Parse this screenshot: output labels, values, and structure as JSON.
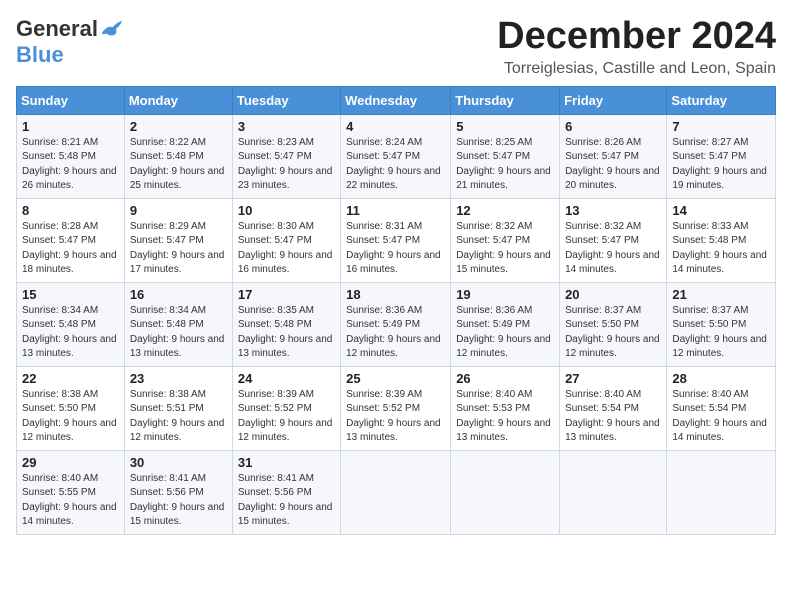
{
  "header": {
    "logo_general": "General",
    "logo_blue": "Blue",
    "month_title": "December 2024",
    "location": "Torreiglesias, Castille and Leon, Spain"
  },
  "calendar": {
    "columns": [
      "Sunday",
      "Monday",
      "Tuesday",
      "Wednesday",
      "Thursday",
      "Friday",
      "Saturday"
    ],
    "weeks": [
      [
        {
          "day": "",
          "info": ""
        },
        {
          "day": "2",
          "info": "Sunrise: 8:22 AM\nSunset: 5:48 PM\nDaylight: 9 hours and 25 minutes."
        },
        {
          "day": "3",
          "info": "Sunrise: 8:23 AM\nSunset: 5:47 PM\nDaylight: 9 hours and 23 minutes."
        },
        {
          "day": "4",
          "info": "Sunrise: 8:24 AM\nSunset: 5:47 PM\nDaylight: 9 hours and 22 minutes."
        },
        {
          "day": "5",
          "info": "Sunrise: 8:25 AM\nSunset: 5:47 PM\nDaylight: 9 hours and 21 minutes."
        },
        {
          "day": "6",
          "info": "Sunrise: 8:26 AM\nSunset: 5:47 PM\nDaylight: 9 hours and 20 minutes."
        },
        {
          "day": "7",
          "info": "Sunrise: 8:27 AM\nSunset: 5:47 PM\nDaylight: 9 hours and 19 minutes."
        }
      ],
      [
        {
          "day": "1",
          "info": "Sunrise: 8:21 AM\nSunset: 5:48 PM\nDaylight: 9 hours and 26 minutes."
        },
        {
          "day": "9",
          "info": "Sunrise: 8:29 AM\nSunset: 5:47 PM\nDaylight: 9 hours and 17 minutes."
        },
        {
          "day": "10",
          "info": "Sunrise: 8:30 AM\nSunset: 5:47 PM\nDaylight: 9 hours and 16 minutes."
        },
        {
          "day": "11",
          "info": "Sunrise: 8:31 AM\nSunset: 5:47 PM\nDaylight: 9 hours and 16 minutes."
        },
        {
          "day": "12",
          "info": "Sunrise: 8:32 AM\nSunset: 5:47 PM\nDaylight: 9 hours and 15 minutes."
        },
        {
          "day": "13",
          "info": "Sunrise: 8:32 AM\nSunset: 5:47 PM\nDaylight: 9 hours and 14 minutes."
        },
        {
          "day": "14",
          "info": "Sunrise: 8:33 AM\nSunset: 5:48 PM\nDaylight: 9 hours and 14 minutes."
        }
      ],
      [
        {
          "day": "8",
          "info": "Sunrise: 8:28 AM\nSunset: 5:47 PM\nDaylight: 9 hours and 18 minutes."
        },
        {
          "day": "16",
          "info": "Sunrise: 8:34 AM\nSunset: 5:48 PM\nDaylight: 9 hours and 13 minutes."
        },
        {
          "day": "17",
          "info": "Sunrise: 8:35 AM\nSunset: 5:48 PM\nDaylight: 9 hours and 13 minutes."
        },
        {
          "day": "18",
          "info": "Sunrise: 8:36 AM\nSunset: 5:49 PM\nDaylight: 9 hours and 12 minutes."
        },
        {
          "day": "19",
          "info": "Sunrise: 8:36 AM\nSunset: 5:49 PM\nDaylight: 9 hours and 12 minutes."
        },
        {
          "day": "20",
          "info": "Sunrise: 8:37 AM\nSunset: 5:50 PM\nDaylight: 9 hours and 12 minutes."
        },
        {
          "day": "21",
          "info": "Sunrise: 8:37 AM\nSunset: 5:50 PM\nDaylight: 9 hours and 12 minutes."
        }
      ],
      [
        {
          "day": "15",
          "info": "Sunrise: 8:34 AM\nSunset: 5:48 PM\nDaylight: 9 hours and 13 minutes."
        },
        {
          "day": "23",
          "info": "Sunrise: 8:38 AM\nSunset: 5:51 PM\nDaylight: 9 hours and 12 minutes."
        },
        {
          "day": "24",
          "info": "Sunrise: 8:39 AM\nSunset: 5:52 PM\nDaylight: 9 hours and 12 minutes."
        },
        {
          "day": "25",
          "info": "Sunrise: 8:39 AM\nSunset: 5:52 PM\nDaylight: 9 hours and 13 minutes."
        },
        {
          "day": "26",
          "info": "Sunrise: 8:40 AM\nSunset: 5:53 PM\nDaylight: 9 hours and 13 minutes."
        },
        {
          "day": "27",
          "info": "Sunrise: 8:40 AM\nSunset: 5:54 PM\nDaylight: 9 hours and 13 minutes."
        },
        {
          "day": "28",
          "info": "Sunrise: 8:40 AM\nSunset: 5:54 PM\nDaylight: 9 hours and 14 minutes."
        }
      ],
      [
        {
          "day": "22",
          "info": "Sunrise: 8:38 AM\nSunset: 5:50 PM\nDaylight: 9 hours and 12 minutes."
        },
        {
          "day": "30",
          "info": "Sunrise: 8:41 AM\nSunset: 5:56 PM\nDaylight: 9 hours and 15 minutes."
        },
        {
          "day": "31",
          "info": "Sunrise: 8:41 AM\nSunset: 5:56 PM\nDaylight: 9 hours and 15 minutes."
        },
        {
          "day": "",
          "info": ""
        },
        {
          "day": "",
          "info": ""
        },
        {
          "day": "",
          "info": ""
        },
        {
          "day": "",
          "info": ""
        }
      ],
      [
        {
          "day": "29",
          "info": "Sunrise: 8:40 AM\nSunset: 5:55 PM\nDaylight: 9 hours and 14 minutes."
        },
        {
          "day": "",
          "info": ""
        },
        {
          "day": "",
          "info": ""
        },
        {
          "day": "",
          "info": ""
        },
        {
          "day": "",
          "info": ""
        },
        {
          "day": "",
          "info": ""
        },
        {
          "day": "",
          "info": ""
        }
      ]
    ]
  }
}
